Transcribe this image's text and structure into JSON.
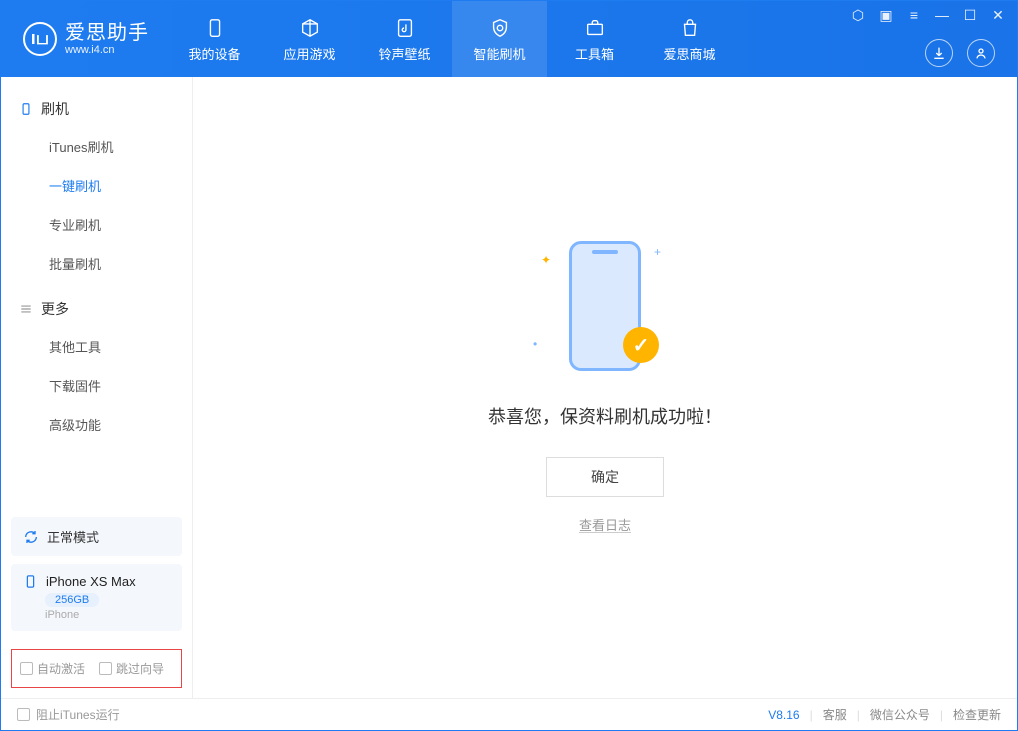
{
  "app": {
    "name": "爱思助手",
    "domain": "www.i4.cn"
  },
  "tabs": {
    "device": "我的设备",
    "apps": "应用游戏",
    "ringtone": "铃声壁纸",
    "flash": "智能刷机",
    "toolbox": "工具箱",
    "store": "爱思商城"
  },
  "sidebar": {
    "group1": {
      "title": "刷机",
      "items": [
        "iTunes刷机",
        "一键刷机",
        "专业刷机",
        "批量刷机"
      ],
      "active_index": 1
    },
    "group2": {
      "title": "更多",
      "items": [
        "其他工具",
        "下载固件",
        "高级功能"
      ]
    }
  },
  "device_mode": {
    "label": "正常模式"
  },
  "device_info": {
    "name": "iPhone XS Max",
    "storage": "256GB",
    "type": "iPhone"
  },
  "options": {
    "auto_activate": "自动激活",
    "skip_guide": "跳过向导"
  },
  "result": {
    "message": "恭喜您，保资料刷机成功啦！",
    "ok": "确定",
    "view_log": "查看日志"
  },
  "footer": {
    "block_itunes": "阻止iTunes运行",
    "version": "V8.16",
    "support": "客服",
    "wechat": "微信公众号",
    "update": "检查更新"
  }
}
